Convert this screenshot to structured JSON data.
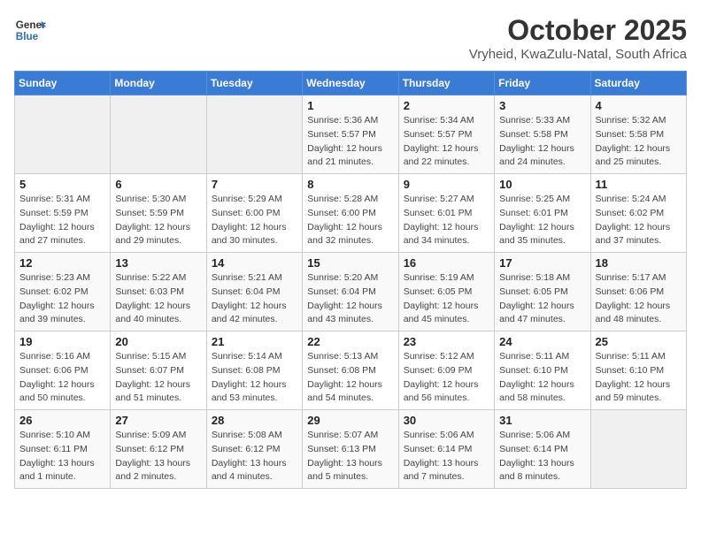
{
  "header": {
    "logo_line1": "General",
    "logo_line2": "Blue",
    "month_year": "October 2025",
    "location": "Vryheid, KwaZulu-Natal, South Africa"
  },
  "days_of_week": [
    "Sunday",
    "Monday",
    "Tuesday",
    "Wednesday",
    "Thursday",
    "Friday",
    "Saturday"
  ],
  "weeks": [
    [
      {
        "day": "",
        "info": ""
      },
      {
        "day": "",
        "info": ""
      },
      {
        "day": "",
        "info": ""
      },
      {
        "day": "1",
        "info": "Sunrise: 5:36 AM\nSunset: 5:57 PM\nDaylight: 12 hours\nand 21 minutes."
      },
      {
        "day": "2",
        "info": "Sunrise: 5:34 AM\nSunset: 5:57 PM\nDaylight: 12 hours\nand 22 minutes."
      },
      {
        "day": "3",
        "info": "Sunrise: 5:33 AM\nSunset: 5:58 PM\nDaylight: 12 hours\nand 24 minutes."
      },
      {
        "day": "4",
        "info": "Sunrise: 5:32 AM\nSunset: 5:58 PM\nDaylight: 12 hours\nand 25 minutes."
      }
    ],
    [
      {
        "day": "5",
        "info": "Sunrise: 5:31 AM\nSunset: 5:59 PM\nDaylight: 12 hours\nand 27 minutes."
      },
      {
        "day": "6",
        "info": "Sunrise: 5:30 AM\nSunset: 5:59 PM\nDaylight: 12 hours\nand 29 minutes."
      },
      {
        "day": "7",
        "info": "Sunrise: 5:29 AM\nSunset: 6:00 PM\nDaylight: 12 hours\nand 30 minutes."
      },
      {
        "day": "8",
        "info": "Sunrise: 5:28 AM\nSunset: 6:00 PM\nDaylight: 12 hours\nand 32 minutes."
      },
      {
        "day": "9",
        "info": "Sunrise: 5:27 AM\nSunset: 6:01 PM\nDaylight: 12 hours\nand 34 minutes."
      },
      {
        "day": "10",
        "info": "Sunrise: 5:25 AM\nSunset: 6:01 PM\nDaylight: 12 hours\nand 35 minutes."
      },
      {
        "day": "11",
        "info": "Sunrise: 5:24 AM\nSunset: 6:02 PM\nDaylight: 12 hours\nand 37 minutes."
      }
    ],
    [
      {
        "day": "12",
        "info": "Sunrise: 5:23 AM\nSunset: 6:02 PM\nDaylight: 12 hours\nand 39 minutes."
      },
      {
        "day": "13",
        "info": "Sunrise: 5:22 AM\nSunset: 6:03 PM\nDaylight: 12 hours\nand 40 minutes."
      },
      {
        "day": "14",
        "info": "Sunrise: 5:21 AM\nSunset: 6:04 PM\nDaylight: 12 hours\nand 42 minutes."
      },
      {
        "day": "15",
        "info": "Sunrise: 5:20 AM\nSunset: 6:04 PM\nDaylight: 12 hours\nand 43 minutes."
      },
      {
        "day": "16",
        "info": "Sunrise: 5:19 AM\nSunset: 6:05 PM\nDaylight: 12 hours\nand 45 minutes."
      },
      {
        "day": "17",
        "info": "Sunrise: 5:18 AM\nSunset: 6:05 PM\nDaylight: 12 hours\nand 47 minutes."
      },
      {
        "day": "18",
        "info": "Sunrise: 5:17 AM\nSunset: 6:06 PM\nDaylight: 12 hours\nand 48 minutes."
      }
    ],
    [
      {
        "day": "19",
        "info": "Sunrise: 5:16 AM\nSunset: 6:06 PM\nDaylight: 12 hours\nand 50 minutes."
      },
      {
        "day": "20",
        "info": "Sunrise: 5:15 AM\nSunset: 6:07 PM\nDaylight: 12 hours\nand 51 minutes."
      },
      {
        "day": "21",
        "info": "Sunrise: 5:14 AM\nSunset: 6:08 PM\nDaylight: 12 hours\nand 53 minutes."
      },
      {
        "day": "22",
        "info": "Sunrise: 5:13 AM\nSunset: 6:08 PM\nDaylight: 12 hours\nand 54 minutes."
      },
      {
        "day": "23",
        "info": "Sunrise: 5:12 AM\nSunset: 6:09 PM\nDaylight: 12 hours\nand 56 minutes."
      },
      {
        "day": "24",
        "info": "Sunrise: 5:11 AM\nSunset: 6:10 PM\nDaylight: 12 hours\nand 58 minutes."
      },
      {
        "day": "25",
        "info": "Sunrise: 5:11 AM\nSunset: 6:10 PM\nDaylight: 12 hours\nand 59 minutes."
      }
    ],
    [
      {
        "day": "26",
        "info": "Sunrise: 5:10 AM\nSunset: 6:11 PM\nDaylight: 13 hours\nand 1 minute."
      },
      {
        "day": "27",
        "info": "Sunrise: 5:09 AM\nSunset: 6:12 PM\nDaylight: 13 hours\nand 2 minutes."
      },
      {
        "day": "28",
        "info": "Sunrise: 5:08 AM\nSunset: 6:12 PM\nDaylight: 13 hours\nand 4 minutes."
      },
      {
        "day": "29",
        "info": "Sunrise: 5:07 AM\nSunset: 6:13 PM\nDaylight: 13 hours\nand 5 minutes."
      },
      {
        "day": "30",
        "info": "Sunrise: 5:06 AM\nSunset: 6:14 PM\nDaylight: 13 hours\nand 7 minutes."
      },
      {
        "day": "31",
        "info": "Sunrise: 5:06 AM\nSunset: 6:14 PM\nDaylight: 13 hours\nand 8 minutes."
      },
      {
        "day": "",
        "info": ""
      }
    ]
  ]
}
